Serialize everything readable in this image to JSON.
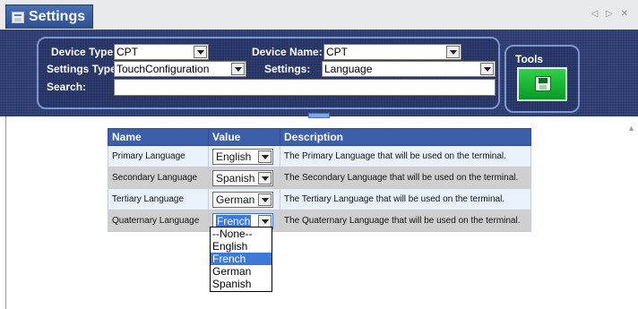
{
  "window": {
    "title": "Settings",
    "icon": "settings-window-icon",
    "nav": "◁ ▷ ✕"
  },
  "filters": {
    "device_type_label": "Device Type:",
    "device_type_value": "CPT",
    "device_name_label": "Device Name:",
    "device_name_value": "CPT",
    "settings_type_label": "Settings Type",
    "settings_type_value": "TouchConfiguration",
    "settings_label": "Settings:",
    "settings_value": "Language",
    "search_label": "Search:",
    "search_value": ""
  },
  "tools": {
    "label": "Tools",
    "save_icon": "save-disk-icon"
  },
  "table": {
    "headers": {
      "name": "Name",
      "value": "Value",
      "description": "Description"
    },
    "rows": [
      {
        "name": "Primary Language",
        "value": "English",
        "description": "The Primary Language that will be used on the terminal."
      },
      {
        "name": "Secondary Language",
        "value": "Spanish",
        "description": "The Secondary Language that will be used on the terminal."
      },
      {
        "name": "Tertiary Language",
        "value": "German",
        "description": "The Tertiary Language that will be used on the terminal."
      },
      {
        "name": "Quaternary Language",
        "value": "French",
        "description": "The Quaternary Language that will be used on the terminal."
      }
    ]
  },
  "dropdown": {
    "options": [
      "--None--",
      "English",
      "French",
      "German",
      "Spanish"
    ],
    "selected": "French"
  },
  "colors": {
    "header_bg": "#2b3b6f",
    "table_header": "#3d5ea9",
    "selection": "#3e79d8",
    "save_green": "#1bb835"
  }
}
